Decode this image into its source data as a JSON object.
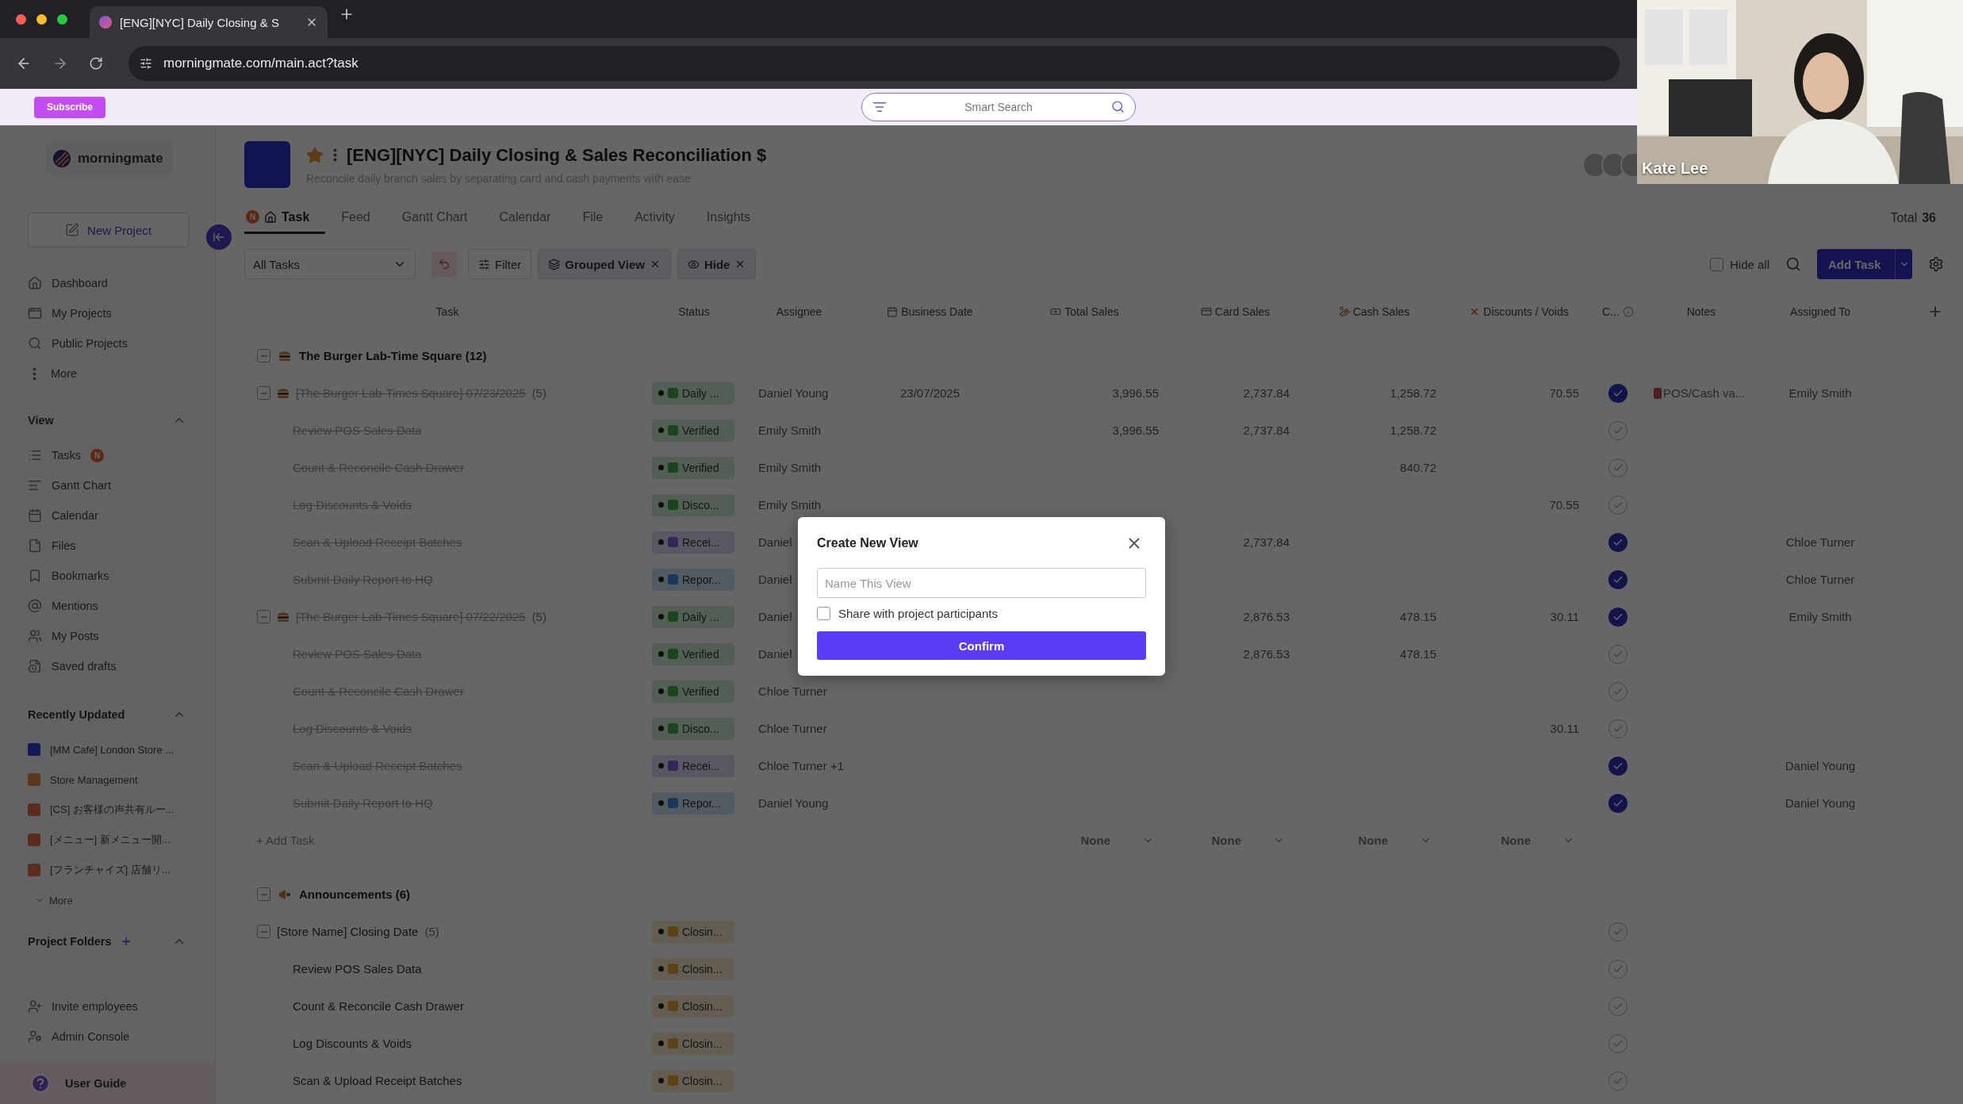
{
  "browser": {
    "tab_title": "[ENG][NYC] Daily Closing & S",
    "url": "morningmate.com/main.act?task"
  },
  "topbar": {
    "subscribe": "Subscribe",
    "search_placeholder": "Smart Search"
  },
  "sidebar": {
    "brand": "morningmate",
    "new_project": "New Project",
    "nav": [
      {
        "label": "Dashboard"
      },
      {
        "label": "My Projects"
      },
      {
        "label": "Public Projects"
      },
      {
        "label": "More"
      }
    ],
    "sections": [
      {
        "kind": "views",
        "title": "View",
        "expanded": true,
        "items": [
          {
            "label": "Tasks",
            "badge": "N"
          },
          {
            "label": "Gantt Chart"
          },
          {
            "label": "Calendar"
          },
          {
            "label": "Files"
          },
          {
            "label": "Bookmarks"
          },
          {
            "label": "Mentions"
          },
          {
            "label": "My Posts"
          },
          {
            "label": "Saved drafts"
          }
        ]
      },
      {
        "kind": "recent",
        "title": "Recently Updated",
        "expanded": true,
        "more": "More",
        "items": [
          {
            "label": "[MM Cafe] London Store ...",
            "color": "#131956"
          },
          {
            "label": "Store Management",
            "color": "#5a371e"
          },
          {
            "label": "[CS] お客様の声共有ルー...",
            "color": "#5a2d1e"
          },
          {
            "label": "[メニュー] 新メニュー開...",
            "color": "#5a2d1e"
          },
          {
            "label": "[フランチャイズ] 店舗リ...",
            "color": "#5a2d1e"
          }
        ]
      },
      {
        "kind": "links",
        "title": "Project Folders",
        "expanded": true,
        "items": [
          {
            "label": "Invite employees"
          },
          {
            "label": "Admin Console"
          }
        ]
      }
    ],
    "user_guide": "User Guide"
  },
  "project": {
    "title": "[ENG][NYC] Daily Closing & Sales Reconciliation $",
    "subtitle": "Reconcile daily branch sales by separating card and cash payments with ease",
    "favorite": true
  },
  "tabs": [
    {
      "label": "Task",
      "selected": true,
      "badge": "N"
    },
    {
      "label": "Feed",
      "selected": false
    },
    {
      "label": "Gantt Chart",
      "selected": false
    },
    {
      "label": "Calendar",
      "selected": false
    },
    {
      "label": "File",
      "selected": false
    },
    {
      "label": "Activity",
      "selected": false
    },
    {
      "label": "Insights",
      "selected": false
    }
  ],
  "total": {
    "label": "Total",
    "count": "36"
  },
  "toolbar": {
    "view": "All Tasks",
    "filter": "Filter",
    "chips": [
      {
        "label": "Grouped View"
      },
      {
        "label": "Hide"
      }
    ],
    "hide_all": {
      "label": "Hide all",
      "checked": false
    },
    "add_task": "Add Task"
  },
  "table": {
    "columns": [
      "Task",
      "Status",
      "Assignee",
      "Business Date",
      "Total Sales",
      "Card Sales",
      "Cash Sales",
      "Discounts / Voids",
      "C...",
      "Notes",
      "Assigned To"
    ],
    "groups": [
      {
        "kind": "store",
        "title": "The Burger Lab-Time Square (12)",
        "expanded": true,
        "add_task": "+ Add Task",
        "summaries": [
          "None",
          "None",
          "None",
          "None"
        ],
        "rows": [
          {
            "kind": "parent",
            "expanded": true,
            "task": "[The Burger Lab-Times Square] 07/23/2025",
            "count": "(5)",
            "completed": true,
            "status": {
              "label": "Daily ...",
              "color": "#19461e"
            },
            "assignee": "Daniel Young",
            "date": "23/07/2025",
            "total": "3,996.55",
            "card": "2,737.84",
            "cash": "1,258.72",
            "discounts": "70.55",
            "checked": true,
            "notes": "POS/Cash va...",
            "assigned_to": "Emily Smith"
          },
          {
            "kind": "task",
            "task": "Review POS Sales Data",
            "completed": true,
            "status": {
              "label": "Verified",
              "color": "#19461e"
            },
            "assignee": "Emily Smith",
            "total": "3,996.55",
            "card": "2,737.84",
            "cash": "1,258.72",
            "checked": false
          },
          {
            "kind": "task",
            "task": "Count & Reconcile Cash Drawer",
            "completed": true,
            "status": {
              "label": "Verified",
              "color": "#19461e"
            },
            "assignee": "Emily Smith",
            "cash": "840.72",
            "checked": false
          },
          {
            "kind": "task",
            "task": "Log Discounts & Voids",
            "completed": true,
            "status": {
              "label": "Disco...",
              "color": "#19461e"
            },
            "assignee": "Emily Smith",
            "discounts": "70.55",
            "checked": false
          },
          {
            "kind": "task",
            "task": "Scan & Upload Receipt Batches",
            "completed": true,
            "status": {
              "label": "Recei...",
              "color": "#372758"
            },
            "assignee": "Daniel",
            "card": "2,737.84",
            "checked": true,
            "assigned_to": "Chloe Turner"
          },
          {
            "kind": "task",
            "task": "Submit Daily Report to HQ",
            "completed": true,
            "status": {
              "label": "Repor...",
              "color": "#193956"
            },
            "assignee": "Daniel",
            "checked": true,
            "assigned_to": "Chloe Turner"
          },
          {
            "kind": "parent",
            "expanded": true,
            "task": "[The Burger Lab-Times Square] 07/22/2025",
            "count": "(5)",
            "completed": true,
            "status": {
              "label": "Daily ...",
              "color": "#19461e"
            },
            "assignee": "Daniel",
            "card": "2,876.53",
            "cash": "478.15",
            "discounts": "30.11",
            "checked": true,
            "assigned_to": "Emily Smith"
          },
          {
            "kind": "task",
            "task": "Review POS Sales Data",
            "completed": true,
            "status": {
              "label": "Verified",
              "color": "#19461e"
            },
            "assignee": "Daniel",
            "card": "2,876.53",
            "cash": "478.15",
            "checked": false
          },
          {
            "kind": "task",
            "task": "Count & Reconcile Cash Drawer",
            "completed": true,
            "status": {
              "label": "Verified",
              "color": "#19461e"
            },
            "assignee": "Chloe Turner",
            "checked": false
          },
          {
            "kind": "task",
            "task": "Log Discounts & Voids",
            "completed": true,
            "status": {
              "label": "Disco...",
              "color": "#19461e"
            },
            "assignee": "Chloe Turner",
            "discounts": "30.11",
            "checked": false
          },
          {
            "kind": "task",
            "task": "Scan & Upload Receipt Batches",
            "completed": true,
            "status": {
              "label": "Recei...",
              "color": "#372758"
            },
            "assignee": "Chloe Turner +1",
            "checked": true,
            "assigned_to": "Daniel Young"
          },
          {
            "kind": "task",
            "task": "Submit Daily Report to HQ",
            "completed": true,
            "status": {
              "label": "Repor...",
              "color": "#193956"
            },
            "assignee": "Daniel Young",
            "checked": true,
            "assigned_to": "Daniel Young"
          }
        ]
      },
      {
        "kind": "announcements",
        "title": "Announcements (6)",
        "expanded": true,
        "rows": [
          {
            "kind": "parent",
            "expanded": true,
            "task": "[Store Name] Closing Date",
            "count": "(5)",
            "completed": false,
            "status": {
              "label": "Closin...",
              "color": "#5d4117"
            },
            "checked": false
          },
          {
            "kind": "task",
            "task": "Review POS Sales Data",
            "completed": false,
            "status": {
              "label": "Closin...",
              "color": "#5d4117"
            },
            "checked": false
          },
          {
            "kind": "task",
            "task": "Count & Reconcile Cash Drawer",
            "completed": false,
            "status": {
              "label": "Closin...",
              "color": "#5d4117"
            },
            "checked": false
          },
          {
            "kind": "task",
            "task": "Log Discounts & Voids",
            "completed": false,
            "status": {
              "label": "Closin...",
              "color": "#5d4117"
            },
            "checked": false
          },
          {
            "kind": "task",
            "task": "Scan & Upload Receipt Batches",
            "completed": false,
            "status": {
              "label": "Closin...",
              "color": "#5d4117"
            },
            "checked": false
          }
        ]
      }
    ]
  },
  "modal": {
    "title": "Create New View",
    "name_placeholder": "Name This View",
    "share": {
      "label": "Share with project participants",
      "checked": false
    },
    "confirm": "Confirm"
  },
  "video": {
    "name": "Kate Lee"
  }
}
